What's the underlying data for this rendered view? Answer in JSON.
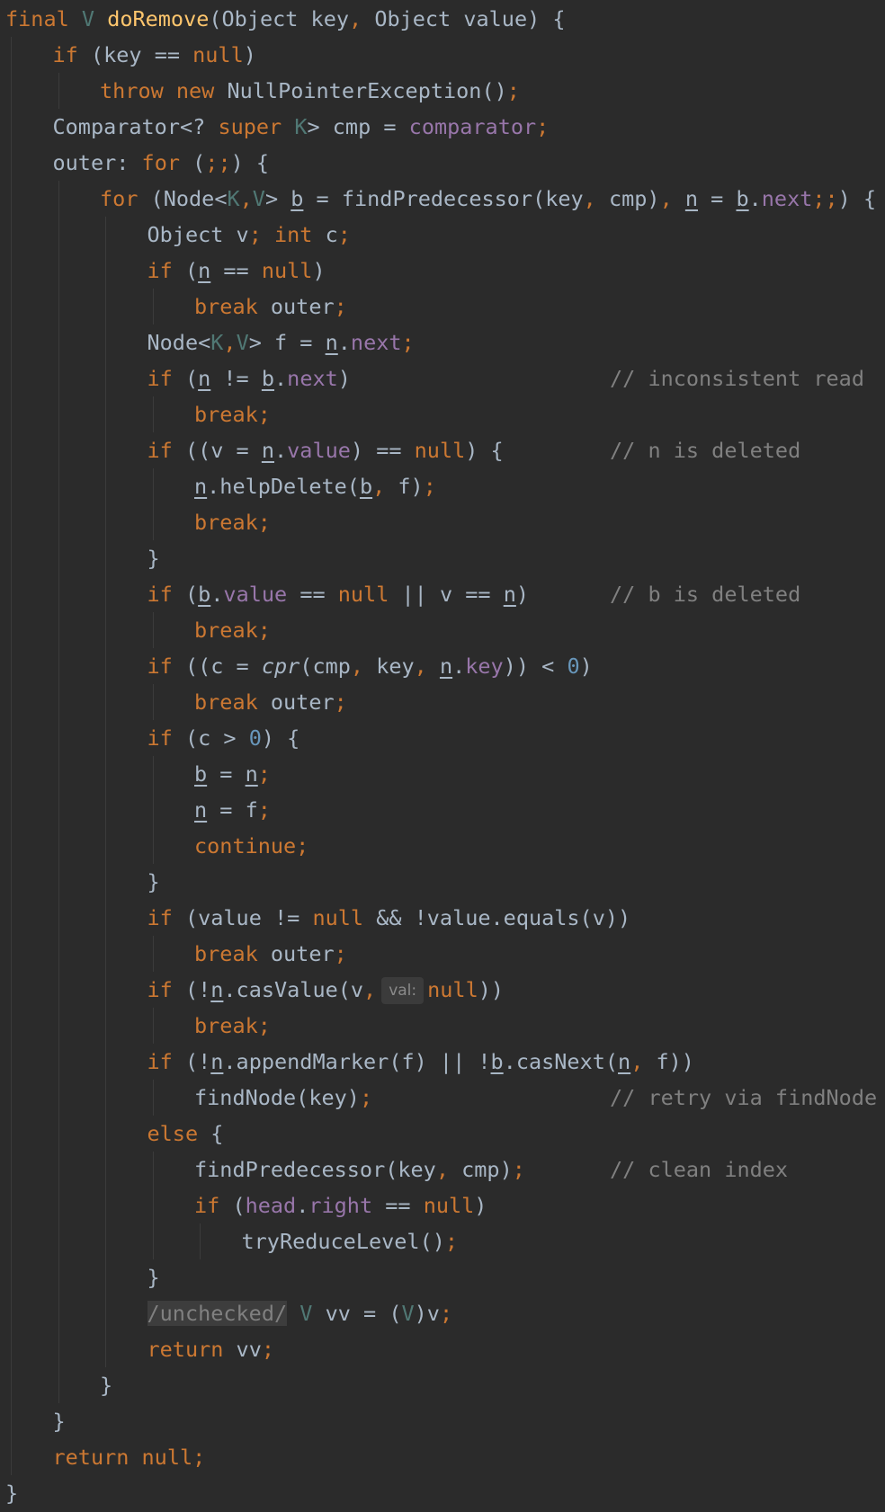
{
  "editor": {
    "theme": "darcula",
    "colors": {
      "background": "#2b2b2b",
      "default_text": "#a9b7c6",
      "keyword": "#cc7832",
      "method_declaration": "#ffc66d",
      "type_parameter": "#507874",
      "field": "#9876aa",
      "number": "#6897bb",
      "comment": "#808080"
    },
    "lines": [
      {
        "indent": 0,
        "tokens": [
          {
            "t": "final ",
            "c": "kw"
          },
          {
            "t": "V ",
            "c": "tp"
          },
          {
            "t": "doRemove",
            "c": "fn"
          },
          {
            "t": "(Object key"
          },
          {
            "t": ", ",
            "c": "kw"
          },
          {
            "t": "Object value) {"
          }
        ]
      },
      {
        "indent": 1,
        "tokens": [
          {
            "t": "if ",
            "c": "kw"
          },
          {
            "t": "(key == "
          },
          {
            "t": "null",
            "c": "kw"
          },
          {
            "t": ")"
          }
        ]
      },
      {
        "indent": 2,
        "tokens": [
          {
            "t": "throw new ",
            "c": "kw"
          },
          {
            "t": "NullPointerException()"
          },
          {
            "t": ";",
            "c": "kw"
          }
        ]
      },
      {
        "indent": 1,
        "tokens": [
          {
            "t": "Comparator<? "
          },
          {
            "t": "super ",
            "c": "kw"
          },
          {
            "t": "K",
            "c": "tp"
          },
          {
            "t": "> cmp = "
          },
          {
            "t": "comparator",
            "c": "fd"
          },
          {
            "t": ";",
            "c": "kw"
          }
        ]
      },
      {
        "indent": 1,
        "tokens": [
          {
            "t": "outer: "
          },
          {
            "t": "for ",
            "c": "kw"
          },
          {
            "t": "("
          },
          {
            "t": ";;",
            "c": "kw"
          },
          {
            "t": ") {"
          }
        ]
      },
      {
        "indent": 2,
        "tokens": [
          {
            "t": "for ",
            "c": "kw"
          },
          {
            "t": "(Node<"
          },
          {
            "t": "K",
            "c": "tp"
          },
          {
            "t": ",",
            "c": "kw"
          },
          {
            "t": "V",
            "c": "tp"
          },
          {
            "t": "> "
          },
          {
            "t": "b",
            "c": "ul"
          },
          {
            "t": " = findPredecessor(key"
          },
          {
            "t": ", ",
            "c": "kw"
          },
          {
            "t": "cmp)"
          },
          {
            "t": ", ",
            "c": "kw"
          },
          {
            "t": "n",
            "c": "ul"
          },
          {
            "t": " = "
          },
          {
            "t": "b",
            "c": "ul"
          },
          {
            "t": "."
          },
          {
            "t": "next",
            "c": "fd"
          },
          {
            "t": ";;",
            "c": "kw"
          },
          {
            "t": ") {"
          }
        ]
      },
      {
        "indent": 3,
        "tokens": [
          {
            "t": "Object v"
          },
          {
            "t": "; ",
            "c": "kw"
          },
          {
            "t": "int ",
            "c": "kw"
          },
          {
            "t": "c"
          },
          {
            "t": ";",
            "c": "kw"
          }
        ]
      },
      {
        "indent": 3,
        "tokens": [
          {
            "t": "if ",
            "c": "kw"
          },
          {
            "t": "("
          },
          {
            "t": "n",
            "c": "ul"
          },
          {
            "t": " == "
          },
          {
            "t": "null",
            "c": "kw"
          },
          {
            "t": ")"
          }
        ]
      },
      {
        "indent": 4,
        "tokens": [
          {
            "t": "break ",
            "c": "kw"
          },
          {
            "t": "outer"
          },
          {
            "t": ";",
            "c": "kw"
          }
        ]
      },
      {
        "indent": 3,
        "tokens": [
          {
            "t": "Node<"
          },
          {
            "t": "K",
            "c": "tp"
          },
          {
            "t": ",",
            "c": "kw"
          },
          {
            "t": "V",
            "c": "tp"
          },
          {
            "t": "> f = "
          },
          {
            "t": "n",
            "c": "ul"
          },
          {
            "t": "."
          },
          {
            "t": "next",
            "c": "fd"
          },
          {
            "t": ";",
            "c": "kw"
          }
        ]
      },
      {
        "indent": 3,
        "comment": "// inconsistent read",
        "tokens": [
          {
            "t": "if ",
            "c": "kw"
          },
          {
            "t": "("
          },
          {
            "t": "n",
            "c": "ul"
          },
          {
            "t": " != "
          },
          {
            "t": "b",
            "c": "ul"
          },
          {
            "t": "."
          },
          {
            "t": "next",
            "c": "fd"
          },
          {
            "t": ")"
          }
        ]
      },
      {
        "indent": 4,
        "tokens": [
          {
            "t": "break;",
            "c": "kw"
          }
        ]
      },
      {
        "indent": 3,
        "comment": "// n is deleted",
        "tokens": [
          {
            "t": "if ",
            "c": "kw"
          },
          {
            "t": "((v = "
          },
          {
            "t": "n",
            "c": "ul"
          },
          {
            "t": "."
          },
          {
            "t": "value",
            "c": "fd"
          },
          {
            "t": ") == "
          },
          {
            "t": "null",
            "c": "kw"
          },
          {
            "t": ") {"
          }
        ]
      },
      {
        "indent": 4,
        "tokens": [
          {
            "t": "n",
            "c": "ul"
          },
          {
            "t": ".helpDelete("
          },
          {
            "t": "b",
            "c": "ul"
          },
          {
            "t": ", ",
            "c": "kw"
          },
          {
            "t": "f)"
          },
          {
            "t": ";",
            "c": "kw"
          }
        ]
      },
      {
        "indent": 4,
        "tokens": [
          {
            "t": "break;",
            "c": "kw"
          }
        ]
      },
      {
        "indent": 3,
        "tokens": [
          {
            "t": "}"
          }
        ]
      },
      {
        "indent": 3,
        "comment": "// b is deleted",
        "tokens": [
          {
            "t": "if ",
            "c": "kw"
          },
          {
            "t": "("
          },
          {
            "t": "b",
            "c": "ul"
          },
          {
            "t": "."
          },
          {
            "t": "value",
            "c": "fd"
          },
          {
            "t": " == "
          },
          {
            "t": "null ",
            "c": "kw"
          },
          {
            "t": "|| v == "
          },
          {
            "t": "n",
            "c": "ul"
          },
          {
            "t": ")"
          }
        ]
      },
      {
        "indent": 4,
        "tokens": [
          {
            "t": "break;",
            "c": "kw"
          }
        ]
      },
      {
        "indent": 3,
        "tokens": [
          {
            "t": "if ",
            "c": "kw"
          },
          {
            "t": "((c = "
          },
          {
            "t": "cpr",
            "c": "it"
          },
          {
            "t": "(cmp"
          },
          {
            "t": ", ",
            "c": "kw"
          },
          {
            "t": "key"
          },
          {
            "t": ", ",
            "c": "kw"
          },
          {
            "t": "n",
            "c": "ul"
          },
          {
            "t": "."
          },
          {
            "t": "key",
            "c": "fd"
          },
          {
            "t": ")) < "
          },
          {
            "t": "0",
            "c": "num"
          },
          {
            "t": ")"
          }
        ]
      },
      {
        "indent": 4,
        "tokens": [
          {
            "t": "break ",
            "c": "kw"
          },
          {
            "t": "outer"
          },
          {
            "t": ";",
            "c": "kw"
          }
        ]
      },
      {
        "indent": 3,
        "tokens": [
          {
            "t": "if ",
            "c": "kw"
          },
          {
            "t": "(c > "
          },
          {
            "t": "0",
            "c": "num"
          },
          {
            "t": ") {"
          }
        ]
      },
      {
        "indent": 4,
        "tokens": [
          {
            "t": "b",
            "c": "ul"
          },
          {
            "t": " = "
          },
          {
            "t": "n",
            "c": "ul"
          },
          {
            "t": ";",
            "c": "kw"
          }
        ]
      },
      {
        "indent": 4,
        "tokens": [
          {
            "t": "n",
            "c": "ul"
          },
          {
            "t": " = f"
          },
          {
            "t": ";",
            "c": "kw"
          }
        ]
      },
      {
        "indent": 4,
        "tokens": [
          {
            "t": "continue;",
            "c": "kw"
          }
        ]
      },
      {
        "indent": 3,
        "tokens": [
          {
            "t": "}"
          }
        ]
      },
      {
        "indent": 3,
        "tokens": [
          {
            "t": "if ",
            "c": "kw"
          },
          {
            "t": "(value != "
          },
          {
            "t": "null ",
            "c": "kw"
          },
          {
            "t": "&& !value.equals(v))"
          }
        ]
      },
      {
        "indent": 4,
        "tokens": [
          {
            "t": "break ",
            "c": "kw"
          },
          {
            "t": "outer"
          },
          {
            "t": ";",
            "c": "kw"
          }
        ]
      },
      {
        "indent": 3,
        "tokens": [
          {
            "t": "if ",
            "c": "kw"
          },
          {
            "t": "(!"
          },
          {
            "t": "n",
            "c": "ul"
          },
          {
            "t": ".casValue(v"
          },
          {
            "t": ",",
            "c": "kw"
          },
          {
            "t": "val:",
            "c": "hint"
          },
          {
            "t": "null",
            "c": "kw"
          },
          {
            "t": "))"
          }
        ]
      },
      {
        "indent": 4,
        "tokens": [
          {
            "t": "break;",
            "c": "kw"
          }
        ]
      },
      {
        "indent": 3,
        "tokens": [
          {
            "t": "if ",
            "c": "kw"
          },
          {
            "t": "(!"
          },
          {
            "t": "n",
            "c": "ul"
          },
          {
            "t": ".appendMarker(f) || !"
          },
          {
            "t": "b",
            "c": "ul"
          },
          {
            "t": ".casNext("
          },
          {
            "t": "n",
            "c": "ul"
          },
          {
            "t": ", ",
            "c": "kw"
          },
          {
            "t": "f))"
          }
        ]
      },
      {
        "indent": 4,
        "comment": "// retry via findNode",
        "tokens": [
          {
            "t": "findNode(key)"
          },
          {
            "t": ";",
            "c": "kw"
          }
        ]
      },
      {
        "indent": 3,
        "tokens": [
          {
            "t": "else ",
            "c": "kw"
          },
          {
            "t": "{"
          }
        ]
      },
      {
        "indent": 4,
        "comment": "// clean index",
        "tokens": [
          {
            "t": "findPredecessor(key"
          },
          {
            "t": ", ",
            "c": "kw"
          },
          {
            "t": "cmp)"
          },
          {
            "t": ";",
            "c": "kw"
          }
        ]
      },
      {
        "indent": 4,
        "tokens": [
          {
            "t": "if ",
            "c": "kw"
          },
          {
            "t": "("
          },
          {
            "t": "head",
            "c": "fd"
          },
          {
            "t": "."
          },
          {
            "t": "right",
            "c": "fd"
          },
          {
            "t": " == "
          },
          {
            "t": "null",
            "c": "kw"
          },
          {
            "t": ")"
          }
        ]
      },
      {
        "indent": 5,
        "tokens": [
          {
            "t": "tryReduceLevel()"
          },
          {
            "t": ";",
            "c": "kw"
          }
        ]
      },
      {
        "indent": 3,
        "tokens": [
          {
            "t": "}"
          }
        ]
      },
      {
        "indent": 3,
        "tokens": [
          {
            "t": "/unchecked/",
            "c": "hl"
          },
          {
            "t": " "
          },
          {
            "t": "V ",
            "c": "tp"
          },
          {
            "t": "vv = ("
          },
          {
            "t": "V",
            "c": "tp"
          },
          {
            "t": ")v"
          },
          {
            "t": ";",
            "c": "kw"
          }
        ]
      },
      {
        "indent": 3,
        "tokens": [
          {
            "t": "return ",
            "c": "kw"
          },
          {
            "t": "vv"
          },
          {
            "t": ";",
            "c": "kw"
          }
        ]
      },
      {
        "indent": 2,
        "tokens": [
          {
            "t": "}"
          }
        ]
      },
      {
        "indent": 1,
        "tokens": [
          {
            "t": "}"
          }
        ]
      },
      {
        "indent": 1,
        "tokens": [
          {
            "t": "return null;",
            "c": "kw"
          }
        ]
      },
      {
        "indent": 0,
        "tokens": [
          {
            "t": "}"
          }
        ]
      }
    ]
  }
}
